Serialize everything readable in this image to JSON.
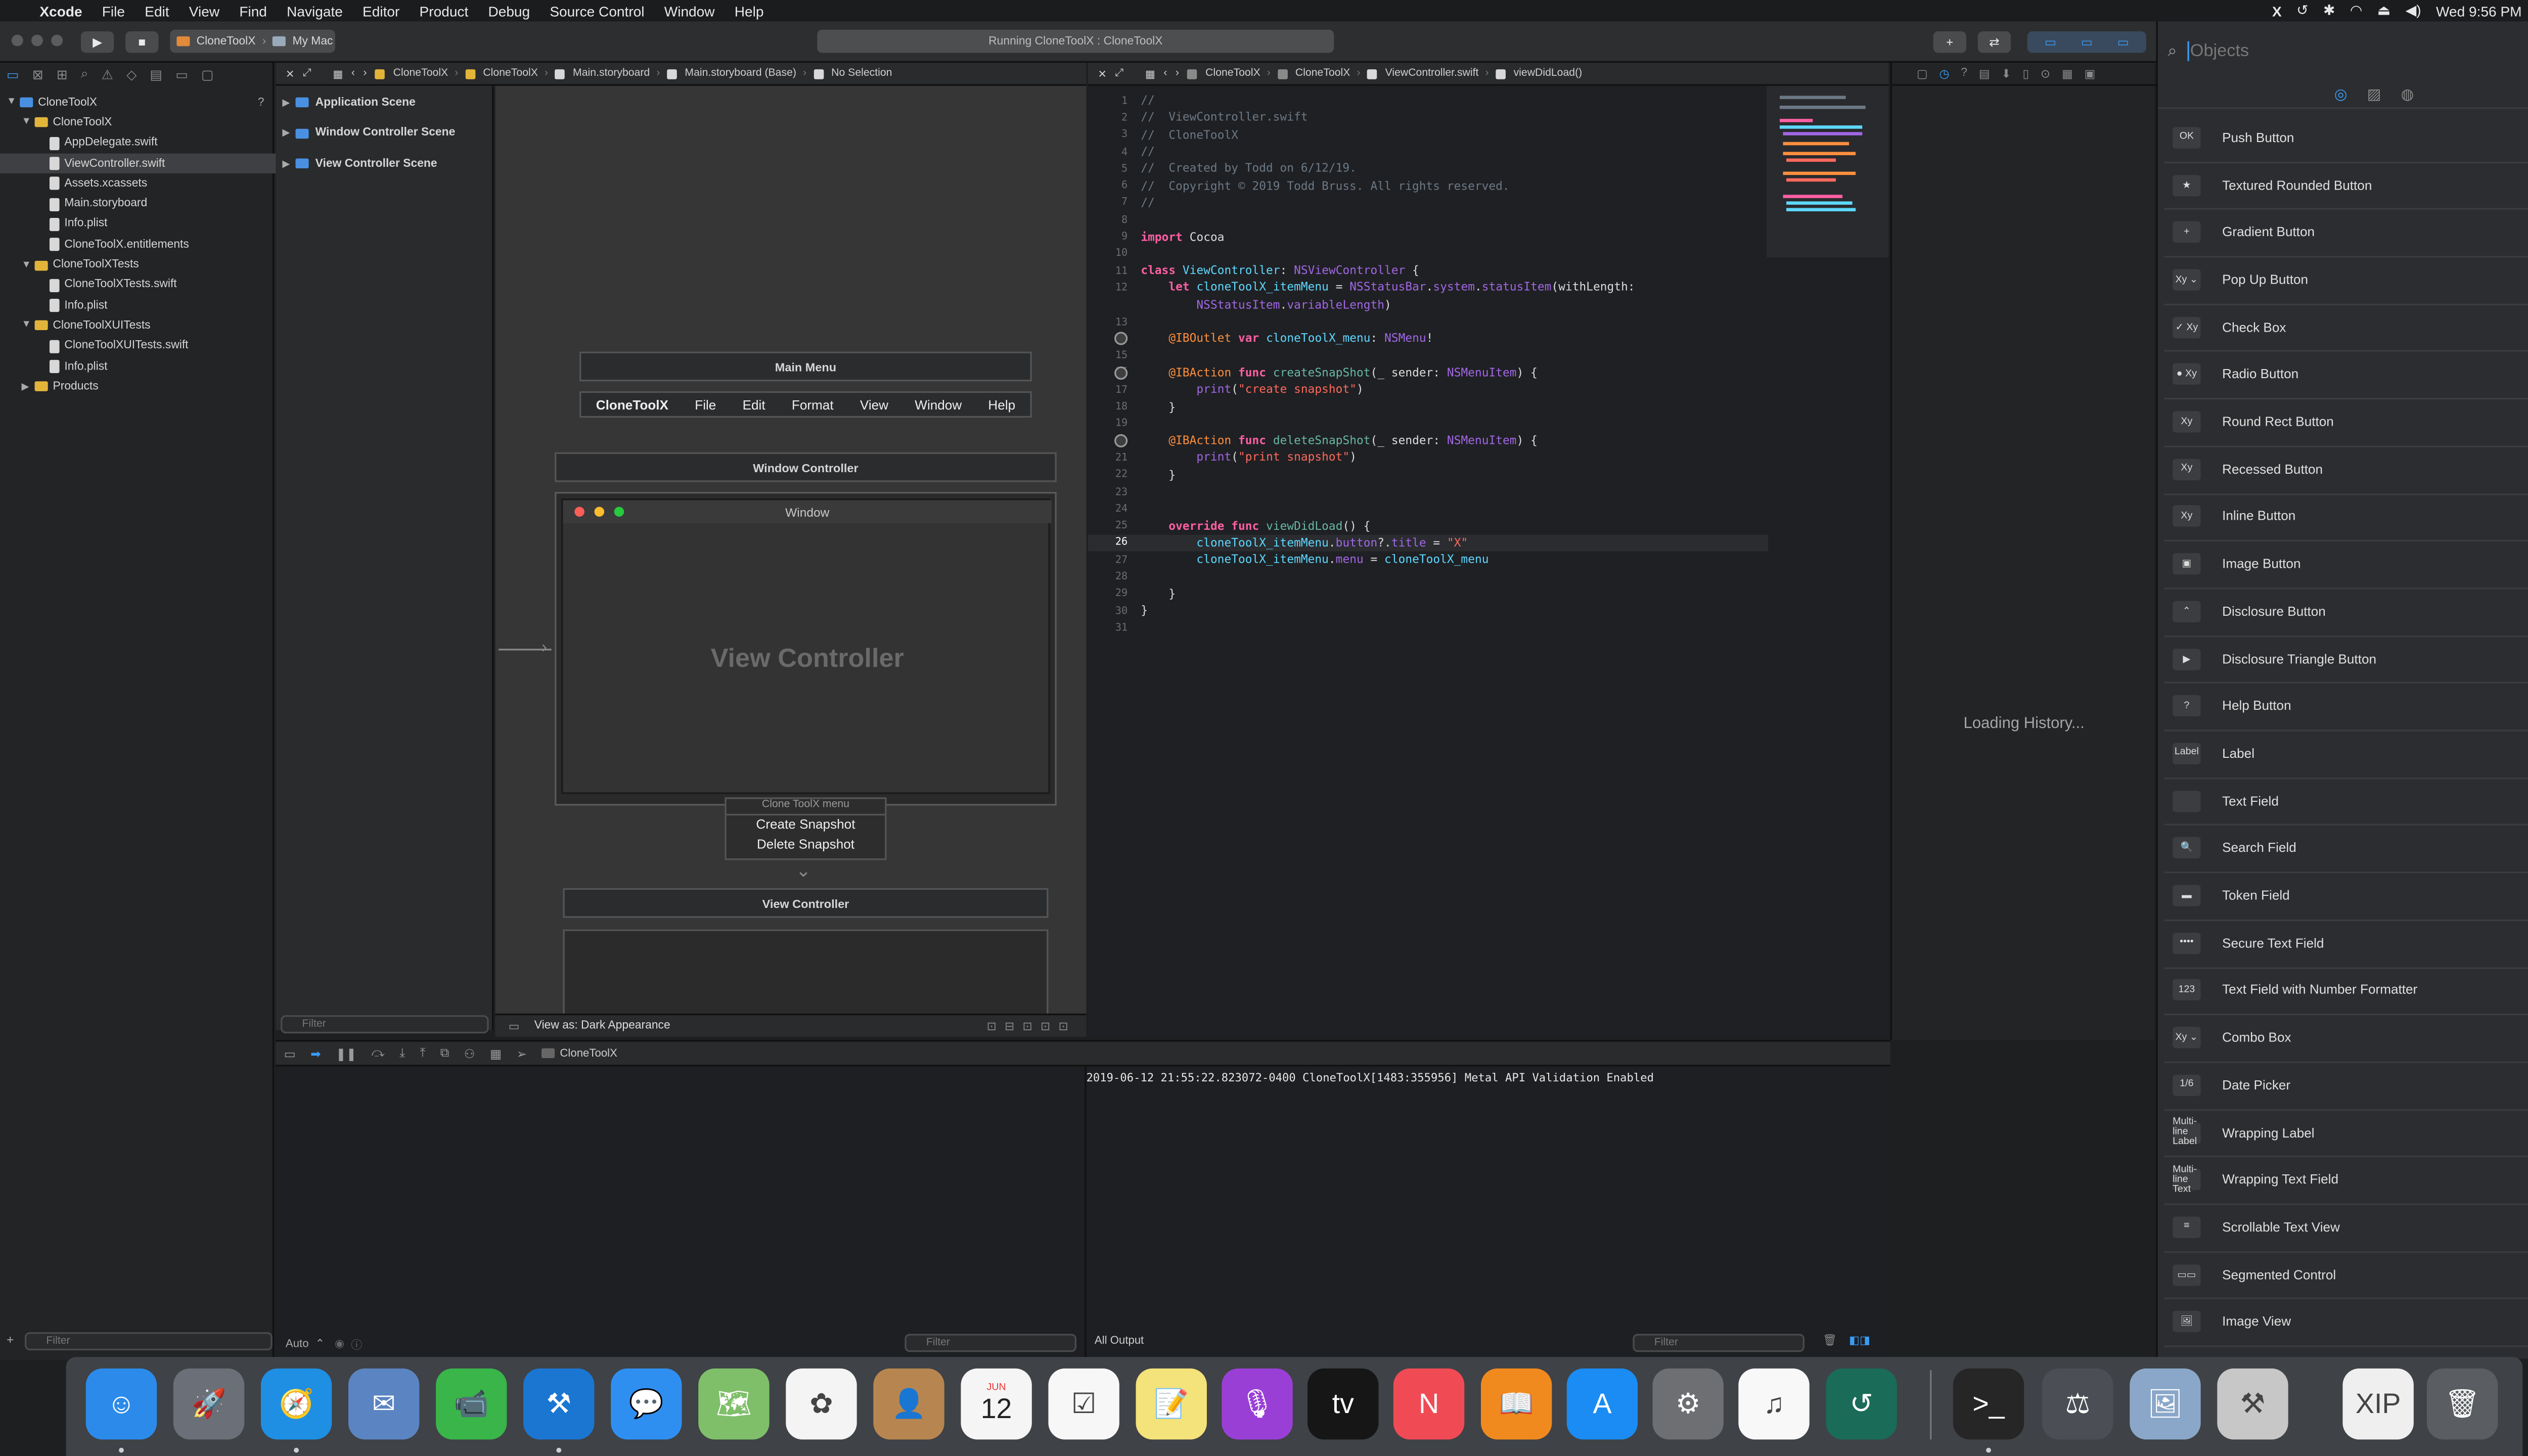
{
  "menubar": {
    "apple": "",
    "app_name": "Xcode",
    "items": [
      "File",
      "Edit",
      "View",
      "Find",
      "Navigate",
      "Editor",
      "Product",
      "Debug",
      "Source Control",
      "Window",
      "Help"
    ],
    "status_item": "X",
    "clock": "Wed 9:56 PM"
  },
  "toolbar": {
    "scheme": "CloneToolX",
    "destination": "My Mac",
    "status": "Running CloneToolX : CloneToolX"
  },
  "navigator": {
    "tree": [
      {
        "label": "CloneToolX",
        "type": "project",
        "indent": 0,
        "disc": "▼",
        "badge": "?"
      },
      {
        "label": "CloneToolX",
        "type": "folder",
        "indent": 1,
        "disc": "▼"
      },
      {
        "label": "AppDelegate.swift",
        "type": "file",
        "indent": 2
      },
      {
        "label": "ViewController.swift",
        "type": "file",
        "indent": 2,
        "selected": true
      },
      {
        "label": "Assets.xcassets",
        "type": "file",
        "indent": 2
      },
      {
        "label": "Main.storyboard",
        "type": "file",
        "indent": 2
      },
      {
        "label": "Info.plist",
        "type": "file",
        "indent": 2
      },
      {
        "label": "CloneToolX.entitlements",
        "type": "file",
        "indent": 2
      },
      {
        "label": "CloneToolXTests",
        "type": "folder",
        "indent": 1,
        "disc": "▼"
      },
      {
        "label": "CloneToolXTests.swift",
        "type": "file",
        "indent": 2
      },
      {
        "label": "Info.plist",
        "type": "file",
        "indent": 2
      },
      {
        "label": "CloneToolXUITests",
        "type": "folder",
        "indent": 1,
        "disc": "▼"
      },
      {
        "label": "CloneToolXUITests.swift",
        "type": "file",
        "indent": 2
      },
      {
        "label": "Info.plist",
        "type": "file",
        "indent": 2
      },
      {
        "label": "Products",
        "type": "folder",
        "indent": 1,
        "disc": "▶"
      }
    ],
    "filter_placeholder": "Filter"
  },
  "storyboard": {
    "jumpbar": [
      "CloneToolX",
      "CloneToolX",
      "Main.storyboard",
      "Main.storyboard (Base)",
      "No Selection"
    ],
    "outline": [
      "Application Scene",
      "Window Controller Scene",
      "View Controller Scene"
    ],
    "outline_filter": "Filter",
    "main_menu_title": "Main Menu",
    "menu_items": [
      "CloneToolX",
      "File",
      "Edit",
      "Format",
      "View",
      "Window",
      "Help"
    ],
    "window_controller_title": "Window Controller",
    "window_title": "Window",
    "view_controller_label": "View Controller",
    "popup_menu_title": "Clone ToolX menu",
    "popup_items": [
      "Create Snapshot",
      "Delete Snapshot"
    ],
    "view_controller_title": "View Controller",
    "view_as": "View as: Dark Appearance"
  },
  "code_editor": {
    "jumpbar": [
      "CloneToolX",
      "CloneToolX",
      "ViewController.swift",
      "viewDidLoad()"
    ],
    "lines": [
      {
        "n": "1",
        "html": "<span class='cm'>//</span>"
      },
      {
        "n": "2",
        "html": "<span class='cm'>//  ViewController.swift</span>"
      },
      {
        "n": "3",
        "html": "<span class='cm'>//  CloneToolX</span>"
      },
      {
        "n": "4",
        "html": "<span class='cm'>//</span>"
      },
      {
        "n": "5",
        "html": "<span class='cm'>//  Created by Todd on 6/12/19.</span>"
      },
      {
        "n": "6",
        "html": "<span class='cm'>//  Copyright © 2019 Todd Bruss. All rights reserved.</span>"
      },
      {
        "n": "7",
        "html": "<span class='cm'>//</span>"
      },
      {
        "n": "8",
        "html": ""
      },
      {
        "n": "9",
        "html": "<span class='kw'>import</span> <span class='tx'>Cocoa</span>"
      },
      {
        "n": "10",
        "html": ""
      },
      {
        "n": "11",
        "html": "<span class='kw'>class</span> <span class='ty'>ViewController</span><span class='tx'>: </span><span class='sy'>NSViewController</span><span class='tx'> {</span>"
      },
      {
        "n": "12",
        "html": "    <span class='kw'>let</span> <span class='ty'>cloneToolX_itemMenu</span><span class='tx'> = </span><span class='sy'>NSStatusBar</span><span class='tx'>.</span><span class='sy'>system</span><span class='tx'>.</span><span class='sy'>statusItem</span><span class='tx'>(withLength:</span>"
      },
      {
        "n": "",
        "html": "        <span class='sy'>NSStatusItem</span><span class='tx'>.</span><span class='sy'>variableLength</span><span class='tx'>)</span>"
      },
      {
        "n": "13",
        "html": ""
      },
      {
        "n": "14",
        "html": "    <span class='attr'>@IBOutlet</span> <span class='kw'>var</span> <span class='ty'>cloneToolX_menu</span><span class='tx'>: </span><span class='sy'>NSMenu</span><span class='tx'>!</span>",
        "bp": true
      },
      {
        "n": "15",
        "html": ""
      },
      {
        "n": "16",
        "html": "    <span class='attr'>@IBAction</span> <span class='kw'>func</span> <span class='fn'>createSnapShot</span><span class='tx'>(_ sender: </span><span class='sy'>NSMenuItem</span><span class='tx'>) {</span>",
        "bp": true
      },
      {
        "n": "17",
        "html": "        <span class='sy'>print</span><span class='tx'>(</span><span class='st'>\"create snapshot\"</span><span class='tx'>)</span>"
      },
      {
        "n": "18",
        "html": "    <span class='tx'>}</span>"
      },
      {
        "n": "19",
        "html": ""
      },
      {
        "n": "20",
        "html": "    <span class='attr'>@IBAction</span> <span class='kw'>func</span> <span class='fn'>deleteSnapShot</span><span class='tx'>(_ sender: </span><span class='sy'>NSMenuItem</span><span class='tx'>) {</span>",
        "bp": true
      },
      {
        "n": "21",
        "html": "        <span class='sy'>print</span><span class='tx'>(</span><span class='st'>\"print snapshot\"</span><span class='tx'>)</span>"
      },
      {
        "n": "22",
        "html": "    <span class='tx'>}</span>"
      },
      {
        "n": "23",
        "html": ""
      },
      {
        "n": "24",
        "html": ""
      },
      {
        "n": "25",
        "html": "    <span class='kw'>override</span> <span class='kw'>func</span> <span class='fn'>viewDidLoad</span><span class='tx'>() {</span>"
      },
      {
        "n": "26",
        "html": "        <span class='ty'>cloneToolX_itemMenu</span><span class='tx'>.</span><span class='sy'>button</span><span class='tx'>?.</span><span class='sy'>title</span><span class='tx'> = </span><span class='st'>\"X\"</span>",
        "cur": true
      },
      {
        "n": "27",
        "html": "        <span class='ty'>cloneToolX_itemMenu</span><span class='tx'>.</span><span class='sy'>menu</span><span class='tx'> = </span><span class='ty'>cloneToolX_menu</span>"
      },
      {
        "n": "28",
        "html": ""
      },
      {
        "n": "29",
        "html": "    <span class='tx'>}</span>"
      },
      {
        "n": "30",
        "html": "<span class='tx'>}</span>"
      },
      {
        "n": "31",
        "html": ""
      }
    ]
  },
  "inspector": {
    "loading_text": "Loading History..."
  },
  "debug": {
    "process": "CloneToolX",
    "variables_scope": "Auto",
    "filter": "Filter",
    "output_filter": "Filter",
    "output_selector": "All Output",
    "console_line": "2019-06-12 21:55:22.823072-0400 CloneToolX[1483:355956] Metal API Validation Enabled"
  },
  "library": {
    "search_placeholder": "Objects",
    "items": [
      {
        "icon": "OK",
        "label": "Push Button"
      },
      {
        "icon": "★",
        "label": "Textured Rounded Button"
      },
      {
        "icon": "+",
        "label": "Gradient Button"
      },
      {
        "icon": "Xy ⌄",
        "label": "Pop Up Button"
      },
      {
        "icon": "✓ Xy",
        "label": "Check Box"
      },
      {
        "icon": "● Xy",
        "label": "Radio Button"
      },
      {
        "icon": "Xy",
        "label": "Round Rect Button"
      },
      {
        "icon": "Xy",
        "label": "Recessed Button"
      },
      {
        "icon": "Xy",
        "label": "Inline Button"
      },
      {
        "icon": "▣",
        "label": "Image Button"
      },
      {
        "icon": "⌃",
        "label": "Disclosure Button"
      },
      {
        "icon": "▶",
        "label": "Disclosure Triangle Button"
      },
      {
        "icon": "?",
        "label": "Help Button"
      },
      {
        "icon": "Label",
        "label": "Label"
      },
      {
        "icon": "",
        "label": "Text Field"
      },
      {
        "icon": "🔍",
        "label": "Search Field"
      },
      {
        "icon": "▬",
        "label": "Token Field"
      },
      {
        "icon": "••••",
        "label": "Secure Text Field"
      },
      {
        "icon": "123",
        "label": "Text Field with Number Formatter"
      },
      {
        "icon": "Xy ⌄",
        "label": "Combo Box"
      },
      {
        "icon": "1/6",
        "label": "Date Picker"
      },
      {
        "icon": "Multi-line Label",
        "label": "Wrapping Label"
      },
      {
        "icon": "Multi-line Text",
        "label": "Wrapping Text Field"
      },
      {
        "icon": "≡",
        "label": "Scrollable Text View"
      },
      {
        "icon": "▭▭",
        "label": "Segmented Control"
      },
      {
        "icon": "🖼",
        "label": "Image View"
      }
    ]
  },
  "dock": {
    "apps": [
      {
        "name": "finder-icon",
        "glyph": "☺",
        "bg": "#2c8bea",
        "running": true
      },
      {
        "name": "launchpad-icon",
        "glyph": "🚀",
        "bg": "#6b7078",
        "running": false
      },
      {
        "name": "safari-icon",
        "glyph": "🧭",
        "bg": "#1e8fe3",
        "running": true
      },
      {
        "name": "mail-icon",
        "glyph": "✉",
        "bg": "#5b84c2",
        "running": false
      },
      {
        "name": "facetime-icon",
        "glyph": "📹",
        "bg": "#39b54a",
        "running": false
      },
      {
        "name": "xcode-icon",
        "glyph": "⚒",
        "bg": "#1b76d2",
        "running": true
      },
      {
        "name": "messages-icon",
        "glyph": "💬",
        "bg": "#2f8ff0",
        "running": false
      },
      {
        "name": "maps-icon",
        "glyph": "🗺",
        "bg": "#7fbf6a",
        "running": false
      },
      {
        "name": "photos-icon",
        "glyph": "✿",
        "bg": "#f4f4f4",
        "running": false
      },
      {
        "name": "contacts-icon",
        "glyph": "👤",
        "bg": "#b78650",
        "running": false
      },
      {
        "name": "calendar-icon",
        "glyph": "12",
        "bg": "#f5f5f5",
        "running": false
      },
      {
        "name": "reminders-icon",
        "glyph": "☑",
        "bg": "#f7f7f7",
        "running": false
      },
      {
        "name": "notes-icon",
        "glyph": "📝",
        "bg": "#f4e27a",
        "running": false
      },
      {
        "name": "podcasts-icon",
        "glyph": "🎙",
        "bg": "#9a3fd6",
        "running": false
      },
      {
        "name": "tv-icon",
        "glyph": "tv",
        "bg": "#161616",
        "running": false
      },
      {
        "name": "news-icon",
        "glyph": "N",
        "bg": "#f04b55",
        "running": false
      },
      {
        "name": "books-icon",
        "glyph": "📖",
        "bg": "#f08a1f",
        "running": false
      },
      {
        "name": "app-store-icon",
        "glyph": "A",
        "bg": "#1a8cf3",
        "running": false
      },
      {
        "name": "system-preferences-icon",
        "glyph": "⚙",
        "bg": "#6d6f73",
        "running": false
      },
      {
        "name": "music-icon",
        "glyph": "♫",
        "bg": "#f8f8f8",
        "running": false
      },
      {
        "name": "time-machine-icon",
        "glyph": "↺",
        "bg": "#1a6b58",
        "running": false
      },
      {
        "name": "terminal-icon",
        "glyph": ">_",
        "bg": "#262626",
        "running": true
      },
      {
        "name": "instruments-icon",
        "glyph": "⚖",
        "bg": "#4b4e55",
        "running": false
      },
      {
        "name": "preview-icon",
        "glyph": "🖼",
        "bg": "#8aa7c9",
        "running": false
      },
      {
        "name": "xcode-archive-icon",
        "glyph": "⚒",
        "bg": "#c7c7c7",
        "running": false
      },
      {
        "name": "xip-file-icon",
        "glyph": "XIP",
        "bg": "#efefef",
        "running": false
      },
      {
        "name": "trash-icon",
        "glyph": "🗑",
        "bg": "#5a5d62",
        "running": false
      }
    ],
    "calendar_month": "JUN",
    "calendar_day": "12"
  }
}
